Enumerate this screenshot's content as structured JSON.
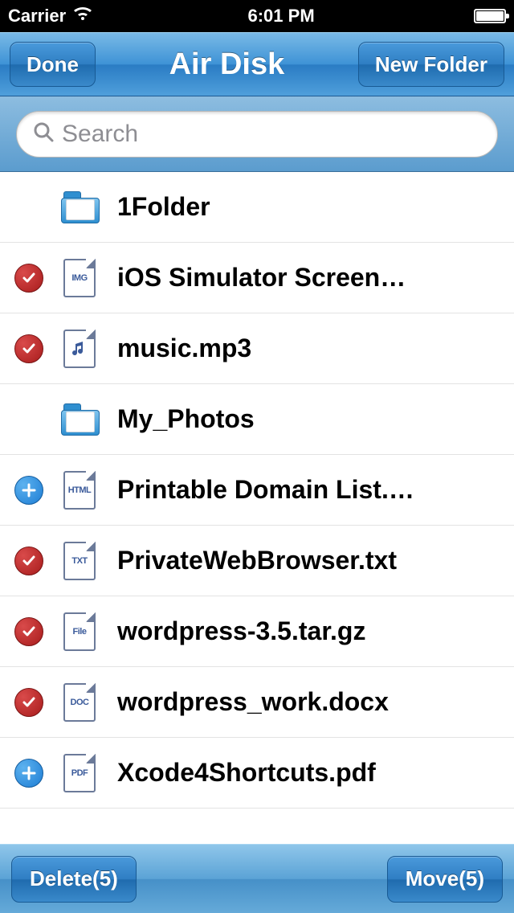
{
  "statusbar": {
    "carrier": "Carrier",
    "time": "6:01 PM"
  },
  "nav": {
    "done": "Done",
    "title": "Air Disk",
    "new_folder": "New Folder"
  },
  "search": {
    "placeholder": "Search"
  },
  "files": [
    {
      "name": "1Folder",
      "type": "folder",
      "state": "none"
    },
    {
      "name": "iOS Simulator Screen…",
      "type": "IMG",
      "state": "checked"
    },
    {
      "name": "music.mp3",
      "type": "audio",
      "state": "checked"
    },
    {
      "name": "My_Photos",
      "type": "folder",
      "state": "none"
    },
    {
      "name": "Printable Domain List.…",
      "type": "HTML",
      "state": "add"
    },
    {
      "name": "PrivateWebBrowser.txt",
      "type": "TXT",
      "state": "checked"
    },
    {
      "name": "wordpress-3.5.tar.gz",
      "type": "File",
      "state": "checked"
    },
    {
      "name": "wordpress_work.docx",
      "type": "DOC",
      "state": "checked"
    },
    {
      "name": "Xcode4Shortcuts.pdf",
      "type": "PDF",
      "state": "add"
    }
  ],
  "toolbar": {
    "delete": "Delete(5)",
    "move": "Move(5)"
  }
}
